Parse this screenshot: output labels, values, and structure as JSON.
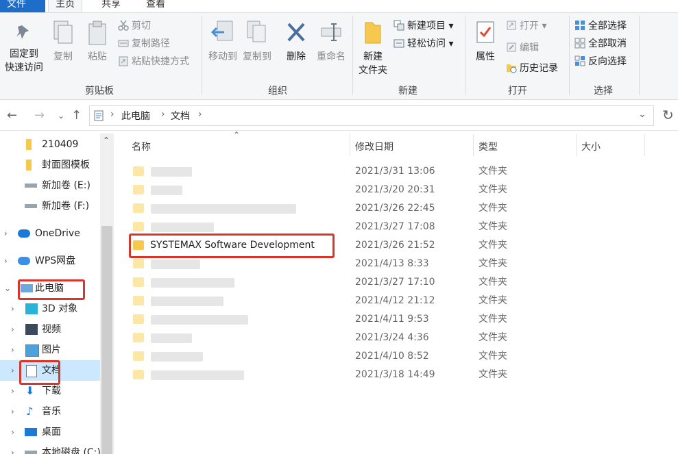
{
  "ribbon_tabs": [
    "文件",
    "主页",
    "共享",
    "查看"
  ],
  "clipboard": {
    "pin_label_1": "固定到",
    "pin_label_2": "快速访问",
    "copy_label": "复制",
    "paste_label": "粘贴",
    "cut_label": "剪切",
    "copy_path_label": "复制路径",
    "paste_shortcut_label": "粘贴快捷方式",
    "group_label": "剪贴板"
  },
  "organize": {
    "move_to_label": "移动到",
    "copy_to_label": "复制到",
    "delete_label": "删除",
    "rename_label": "重命名",
    "group_label": "组织"
  },
  "new_group": {
    "new_folder_1": "新建",
    "new_folder_2": "文件夹",
    "new_item_label": "新建项目",
    "easy_access_label": "轻松访问",
    "group_label": "新建"
  },
  "open_group": {
    "properties_label": "属性",
    "open_label": "打开",
    "edit_label": "编辑",
    "history_label": "历史记录",
    "group_label": "打开"
  },
  "select_group": {
    "select_all_label": "全部选择",
    "select_none_label": "全部取消",
    "invert_label": "反向选择",
    "group_label": "选择"
  },
  "address": {
    "crumbs": [
      "此电脑",
      "文档"
    ],
    "refresh_icon": "refresh-icon"
  },
  "nav_items": [
    {
      "label": "210409",
      "icon": "folder-icon"
    },
    {
      "label": "封面图模板",
      "icon": "folder-icon"
    },
    {
      "label": "新加卷 (E:)",
      "icon": "drive-icon"
    },
    {
      "label": "新加卷 (F:)",
      "icon": "drive-icon"
    },
    {
      "label": "OneDrive",
      "icon": "cloud-icon"
    },
    {
      "label": "WPS网盘",
      "icon": "cloud-icon"
    },
    {
      "label": "此电脑",
      "icon": "computer-icon"
    },
    {
      "label": "3D 对象",
      "icon": "cube-icon"
    },
    {
      "label": "视频",
      "icon": "film-icon"
    },
    {
      "label": "图片",
      "icon": "picture-icon"
    },
    {
      "label": "文档",
      "icon": "document-icon"
    },
    {
      "label": "下载",
      "icon": "download-icon"
    },
    {
      "label": "音乐",
      "icon": "music-icon"
    },
    {
      "label": "桌面",
      "icon": "desktop-icon"
    },
    {
      "label": "本地磁盘 (C:)",
      "icon": "drive-icon"
    }
  ],
  "columns": {
    "name": "名称",
    "date": "修改日期",
    "type": "类型",
    "size": "大小"
  },
  "files": [
    {
      "name": "",
      "date": "2021/3/31 13:06",
      "type": "文件夹"
    },
    {
      "name": "",
      "date": "2021/3/20 20:31",
      "type": "文件夹"
    },
    {
      "name": "",
      "date": "2021/3/26 22:45",
      "type": "文件夹"
    },
    {
      "name": "",
      "date": "2021/3/27 17:08",
      "type": "文件夹"
    },
    {
      "name": "SYSTEMAX Software Development",
      "date": "2021/3/26 21:52",
      "type": "文件夹"
    },
    {
      "name": "",
      "date": "2021/4/13 8:33",
      "type": "文件夹"
    },
    {
      "name": "",
      "date": "2021/3/27 17:10",
      "type": "文件夹"
    },
    {
      "name": "",
      "date": "2021/4/12 21:12",
      "type": "文件夹"
    },
    {
      "name": "",
      "date": "2021/4/11 9:53",
      "type": "文件夹"
    },
    {
      "name": "",
      "date": "2021/3/24 4:36",
      "type": "文件夹"
    },
    {
      "name": "",
      "date": "2021/4/10 8:52",
      "type": "文件夹"
    },
    {
      "name": "",
      "date": "2021/3/18 14:49",
      "type": "文件夹"
    }
  ]
}
